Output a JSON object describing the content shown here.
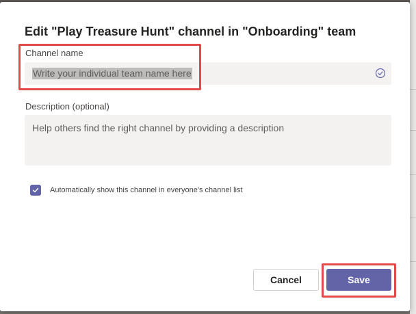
{
  "dialog": {
    "title": "Edit \"Play Treasure Hunt\" channel in \"Onboarding\" team"
  },
  "channel_name": {
    "label": "Channel name",
    "value": "Write your individual team name here",
    "status_icon": "circle-check-icon"
  },
  "description": {
    "label": "Description (optional)",
    "placeholder": "Help others find the right channel by providing a description"
  },
  "auto_show": {
    "checked": true,
    "label": "Automatically show this channel in everyone's channel list"
  },
  "actions": {
    "cancel_label": "Cancel",
    "save_label": "Save"
  },
  "colors": {
    "accent": "#6264a7",
    "highlight": "#e24a4a",
    "field_bg": "#f3f2f1"
  }
}
